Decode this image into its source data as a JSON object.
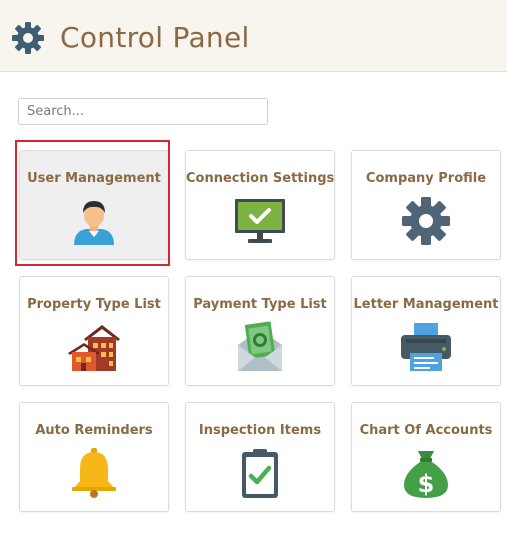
{
  "header": {
    "title": "Control Panel",
    "icon": "gear-icon",
    "title_color": "#8a6a45",
    "background": "#f8f4ee"
  },
  "search": {
    "placeholder": "Search...",
    "value": ""
  },
  "tiles": [
    {
      "label": "User Management",
      "icon": "user-icon",
      "selected": true
    },
    {
      "label": "Connection Settings",
      "icon": "monitor-check-icon",
      "selected": false
    },
    {
      "label": "Company Profile",
      "icon": "gear-icon",
      "selected": false
    },
    {
      "label": "Property Type List",
      "icon": "buildings-icon",
      "selected": false
    },
    {
      "label": "Payment Type List",
      "icon": "money-envelope-icon",
      "selected": false
    },
    {
      "label": "Letter Management",
      "icon": "printer-icon",
      "selected": false
    },
    {
      "label": "Auto Reminders",
      "icon": "bell-icon",
      "selected": false
    },
    {
      "label": "Inspection Items",
      "icon": "clipboard-check-icon",
      "selected": false
    },
    {
      "label": "Chart Of Accounts",
      "icon": "money-bag-icon",
      "selected": false
    }
  ],
  "colors": {
    "selection_border": "#d6262c",
    "label": "#8a6a45"
  }
}
